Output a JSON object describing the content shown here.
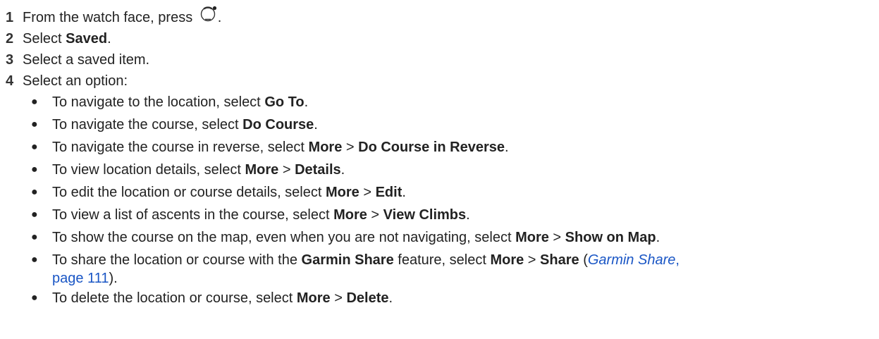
{
  "steps": [
    {
      "num": "1",
      "text_before": "From the watch face, press ",
      "icon": "start-stop-button-icon",
      "text_after": "."
    },
    {
      "num": "2",
      "text_before": "Select ",
      "bold": "Saved",
      "text_after": "."
    },
    {
      "num": "3",
      "text": "Select a saved item."
    },
    {
      "num": "4",
      "text": "Select an option:"
    }
  ],
  "options": {
    "go_to": {
      "pre": "To navigate to the location, select ",
      "b1": "Go To",
      "post": "."
    },
    "do_course": {
      "pre": "To navigate the course, select ",
      "b1": "Do Course",
      "post": "."
    },
    "reverse": {
      "pre": "To navigate the course in reverse, select ",
      "b1": "More",
      "sep": " > ",
      "b2": "Do Course in Reverse",
      "post": "."
    },
    "details": {
      "pre": "To view location details, select ",
      "b1": "More",
      "sep": " > ",
      "b2": "Details",
      "post": "."
    },
    "edit": {
      "pre": "To edit the location or course details, select ",
      "b1": "More",
      "sep": " > ",
      "b2": "Edit",
      "post": "."
    },
    "climbs": {
      "pre": "To view a list of ascents in the course, select ",
      "b1": "More",
      "sep": " > ",
      "b2": "View Climbs",
      "post": "."
    },
    "show_map": {
      "pre": "To show the course on the map, even when you are not navigating, select ",
      "b1": "More",
      "sep": " > ",
      "b2": "Show on Map",
      "post": "."
    },
    "share": {
      "pre": "To share the location or course with the ",
      "b_feature": "Garmin Share",
      "mid": " feature, select ",
      "b1": "More",
      "sep": " > ",
      "b2": "Share",
      "paren_open": " (",
      "link_title": "Garmin Share",
      "link_comma": ",",
      "link_page": "page 111",
      "paren_close": ")."
    },
    "delete": {
      "pre": "To delete the location or course, select ",
      "b1": "More",
      "sep": " > ",
      "b2": "Delete",
      "post": "."
    }
  },
  "bullet_glyph": "●",
  "colors": {
    "text": "#222222",
    "link": "#1a56c5"
  }
}
